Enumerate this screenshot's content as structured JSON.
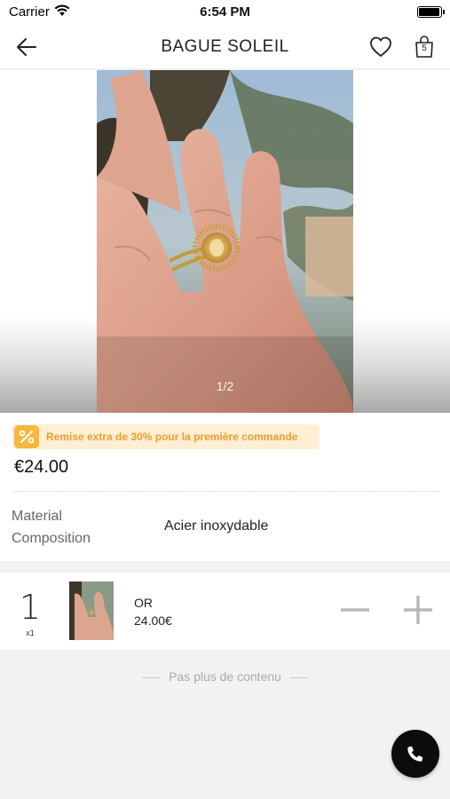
{
  "status": {
    "carrier": "Carrier",
    "time": "6:54 PM"
  },
  "nav": {
    "title": "BAGUE SOLEIL",
    "cart_count": "5",
    "icons": [
      "back-arrow-icon",
      "heart-icon",
      "shopping-bag-icon"
    ]
  },
  "gallery": {
    "indicator": "1/2"
  },
  "product": {
    "promo": "Remise extra de 30% pour la première commande",
    "price": "€24.00",
    "spec_label": "Material Composition",
    "spec_value": "Acier inoxydable"
  },
  "cart_line": {
    "quantity": "1",
    "quantity_sub": "x1",
    "variant_name": "OR",
    "variant_price": "24.00€"
  },
  "footer": {
    "end_note": "Pas plus de contenu"
  },
  "colors": {
    "promo_bg": "#fdeed4",
    "promo_accent": "#f5b73c",
    "call_button": "#0c0c0c"
  }
}
